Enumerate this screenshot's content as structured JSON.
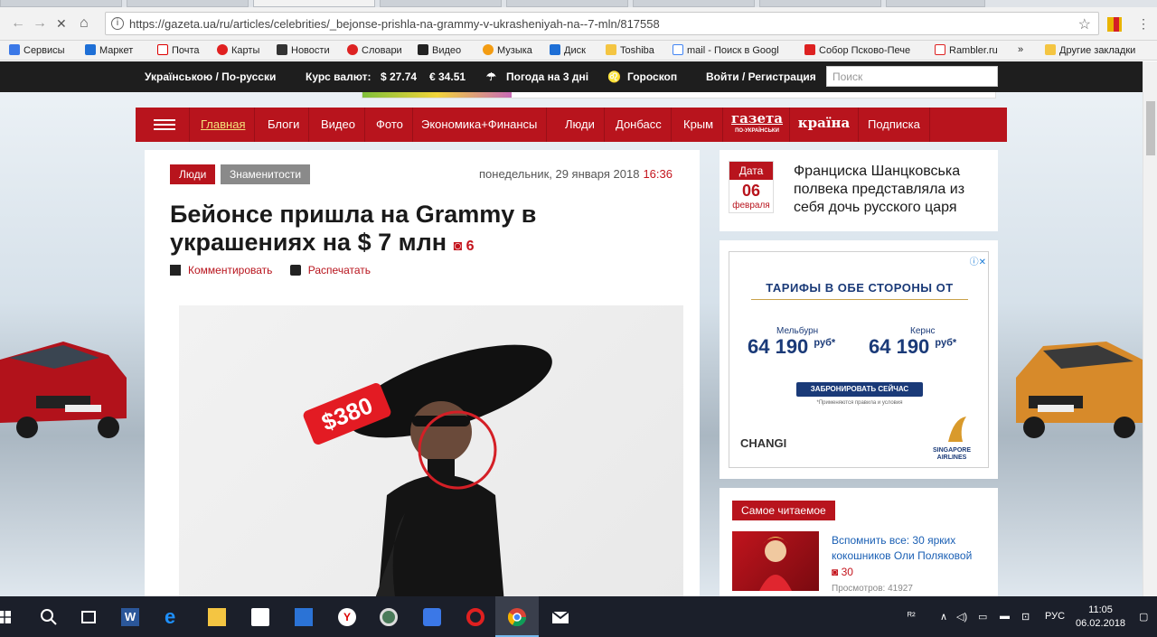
{
  "browser": {
    "url": "https://gazeta.ua/ru/articles/celebrities/_bejonse-prishla-na-grammy-v-ukrasheniyah-na--7-mln/817558",
    "bookmarks": [
      "Сервисы",
      "Маркет",
      "Почта",
      "Карты",
      "Новости",
      "Словари",
      "Видео",
      "Музыка",
      "Диск",
      "Toshiba",
      "mail - Поиск в Googl",
      "Собор Псково-Пече",
      "Rambler.ru",
      "»",
      "Другие закладки"
    ]
  },
  "topbar": {
    "language": "Українською / По-русски",
    "rates_label": "Курс валют:",
    "usd": "$ 27.74",
    "eur": "€ 34.51",
    "weather": "Погода на 3 дні",
    "horoscope": "Гороскоп",
    "login": "Войти / Регистрация",
    "search_placeholder": "Поиск"
  },
  "nav": {
    "items": [
      "Главная",
      "Блоги",
      "Видео",
      "Фото",
      "Экономика+Финансы",
      "Люди",
      "Донбасс",
      "Крым"
    ],
    "logo1": "газета",
    "logo1_sub": "ПО-УКРАЇНСЬКИ",
    "logo2": "країна",
    "subscribe": "Подписка"
  },
  "article": {
    "tags": [
      "Люди",
      "Знаменитости"
    ],
    "date": "понедельник, 29 января 2018",
    "time": "16:36",
    "title": "Бейонсе пришла на Grammy в украшениях на $ 7 млн",
    "photo_count": "6",
    "comment": "Комментировать",
    "print": "Распечатать",
    "price_tag": "$380"
  },
  "sidebar": {
    "history": {
      "label": "Дата",
      "day": "06",
      "month": "февраля",
      "text": "Франциска Шанцковська полвека представляла из себя дочь русского царя"
    },
    "ad": {
      "headline": "ТАРИФЫ В ОБЕ СТОРОНЫ ОТ",
      "city1": "Мельбурн",
      "price1": "64 190",
      "city2": "Кернс",
      "price2": "64 190",
      "currency": "руб*",
      "button": "ЗАБРОНИРОВАТЬ СЕЙЧАС",
      "note": "*Применяются правила и условия",
      "brand1": "CHANGI",
      "brand2": "SINGAPORE AIRLINES"
    },
    "most_read": {
      "label": "Самое читаемое",
      "title": "Вспомнить все: 30 ярких кокошников Оли Поляковой",
      "count": "30",
      "views": "Просмотров: 41927"
    }
  },
  "taskbar": {
    "lang": "РУС",
    "time": "11:05",
    "date": "06.02.2018"
  },
  "colors": {
    "brand": "#b8141d",
    "link": "#1a5fb4",
    "dark": "#1e1e1e"
  }
}
